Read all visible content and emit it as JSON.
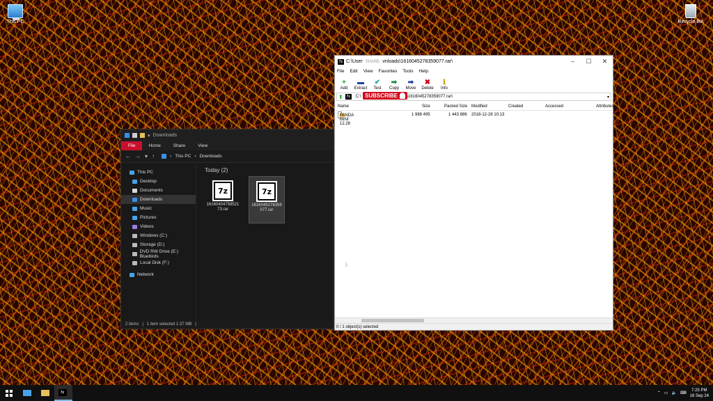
{
  "desktop": {
    "icons": [
      {
        "label": "This PC"
      },
      {
        "label": "Recycle Bin"
      }
    ]
  },
  "explorer": {
    "title": "Downloads",
    "ribbon_tabs": [
      "File",
      "Home",
      "Share",
      "View"
    ],
    "path": [
      "This PC",
      "Downloads"
    ],
    "sidebar": [
      {
        "label": "This PC"
      },
      {
        "label": "Desktop"
      },
      {
        "label": "Documents"
      },
      {
        "label": "Downloads"
      },
      {
        "label": "Music"
      },
      {
        "label": "Pictures"
      },
      {
        "label": "Videos"
      },
      {
        "label": "Windows (C:)"
      },
      {
        "label": "Storage (D:)"
      },
      {
        "label": "DVD RW Drive (E:) Bluebirds"
      },
      {
        "label": "Local Disk (F:)"
      },
      {
        "label": "Network"
      }
    ],
    "group_label": "Today (2)",
    "files": [
      {
        "name": "1616040475852173.rar",
        "icon": "7z"
      },
      {
        "name": "1616045278359077.rar",
        "icon": "7z"
      }
    ],
    "status": {
      "items": "2 items",
      "selected": "1 item selected  1.37 MB"
    }
  },
  "sevenzip": {
    "title_left": "C:\\User",
    "title_share": "SHARE",
    "title_right": "vnloads\\1616045278359077.rar\\",
    "menu": [
      "File",
      "Edit",
      "View",
      "Favorites",
      "Tools",
      "Help"
    ],
    "toolbar": [
      {
        "label": "Add",
        "glyph": "+",
        "color": "#1a9e1a"
      },
      {
        "label": "Extract",
        "glyph": "▬",
        "color": "#1b3fa8"
      },
      {
        "label": "Test",
        "glyph": "✔",
        "color": "#1aa3a3"
      },
      {
        "label": "Copy",
        "glyph": "➡",
        "color": "#1a8a3a"
      },
      {
        "label": "Move",
        "glyph": "➡",
        "color": "#1b3fa8"
      },
      {
        "label": "Delete",
        "glyph": "✖",
        "color": "#d0021b"
      },
      {
        "label": "Info",
        "glyph": "ℹ",
        "color": "#c8a000"
      }
    ],
    "address_left": "C:\\",
    "address_right": "oads\\1616045278359077.rar\\",
    "subscribe": "SUBSCRIBE",
    "columns": [
      "Name",
      "Size",
      "Packed Size",
      "Modified",
      "Created",
      "Accessed",
      "Attributes"
    ],
    "rows": [
      {
        "name": "PANDA MINI 12.28",
        "size": "1 988 495",
        "packed": "1 443 886",
        "modified": "2018-12-28 10:13"
      }
    ],
    "status": "0 / 1 object(s) selected"
  },
  "taskbar": {
    "time": "7:25 PM",
    "date": "16 Sep 24"
  }
}
